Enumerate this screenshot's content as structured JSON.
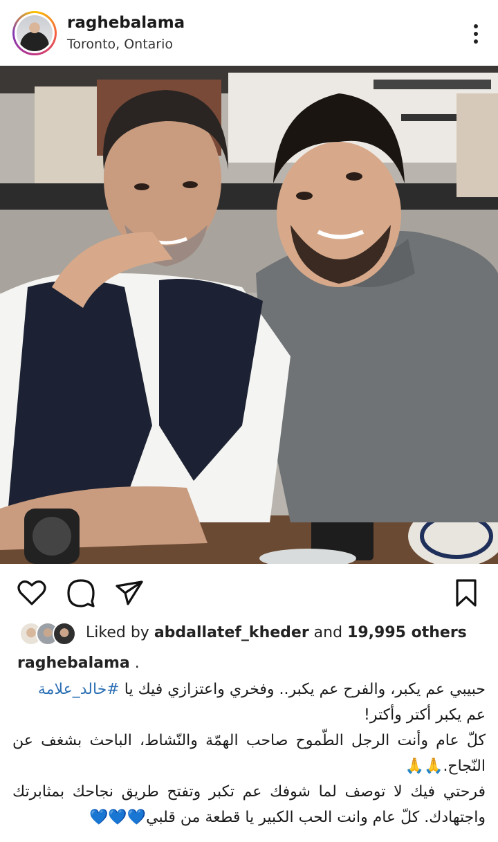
{
  "post": {
    "username": "raghebalama",
    "location": "Toronto, Ontario"
  },
  "likes": {
    "prefix": "Liked by",
    "user": "abdallatef_kheder",
    "and": "and",
    "count": "19,995 others"
  },
  "caption": {
    "username": "raghebalama",
    "suffix": " .",
    "line1": "حبيبي عم يكبر، والفرح عم يكبر.. وفخري واعتزازي فيك يا ",
    "hashtag": "#خالد_علامة",
    "line2": "عم يكبر أكتر وأكتر!",
    "line3": "كلّ عام وأنت الرجل الطّموح صاحب الهمّة والنّشاط، الباحث بشغف عن النّجاح.🙏🙏",
    "line4": "فرحتي فيك لا توصف لما شوفك عم تكبر وتفتح طريق نجاحك بمثابرتك واجتهادك. كلّ عام وانت الحب الكبير يا قطعة من قلبي💙💙💙"
  },
  "icons": {
    "more": "more-options-icon",
    "like": "heart-icon",
    "comment": "comment-icon",
    "share": "send-icon",
    "save": "bookmark-icon"
  }
}
